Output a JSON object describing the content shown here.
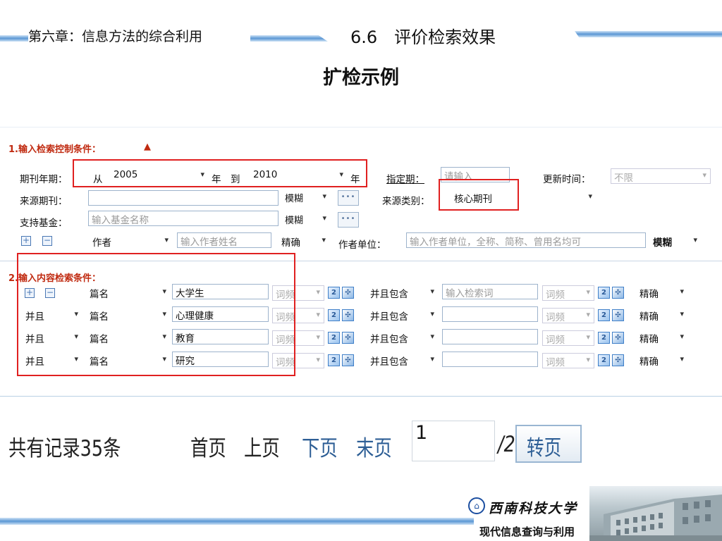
{
  "header": {
    "chapter": "第六章：信息方法的综合利用",
    "section": "6.6　评价检索效果",
    "title": "扩检示例"
  },
  "control": {
    "heading": "1.输入检索控制条件：",
    "year_label": "期刊年期：",
    "from": "从",
    "from_value": "2005",
    "year": "年",
    "to": "到",
    "to_value": "2010",
    "year2": "年",
    "period_label": "指定期：",
    "period_ph": "请输入",
    "update_label": "更新时间：",
    "update_value": "不限",
    "source_label": "来源期刊：",
    "fuzzy": "模糊",
    "type_label": "来源类别：",
    "type_value": "核心期刊",
    "fund_label": "支持基金：",
    "fund_ph": "输入基金名称",
    "fuzzy2": "模糊",
    "author_sel": "作者",
    "author_ph": "输入作者姓名",
    "exact": "精确",
    "unit_label": "作者单位：",
    "unit_ph": "输入作者单位，全称、简称、曾用名均可",
    "fuzzy3": "模糊"
  },
  "content": {
    "heading": "2.输入内容检索条件：",
    "rows": [
      {
        "logic": "",
        "field": "篇名",
        "term": "大学生",
        "freq": "词频",
        "op": "并且包含",
        "term2_ph": "输入检索词",
        "freq2": "词频",
        "match": "精确"
      },
      {
        "logic": "并且",
        "field": "篇名",
        "term": "心理健康",
        "freq": "词频",
        "op": "并且包含",
        "term2_ph": "",
        "freq2": "词频",
        "match": "精确"
      },
      {
        "logic": "并且",
        "field": "篇名",
        "term": "教育",
        "freq": "词频",
        "op": "并且包含",
        "term2_ph": "",
        "freq2": "词频",
        "match": "精确"
      },
      {
        "logic": "并且",
        "field": "篇名",
        "term": "研究",
        "freq": "词频",
        "op": "并且包含",
        "term2_ph": "",
        "freq2": "词频",
        "match": "精确"
      }
    ]
  },
  "pager": {
    "total": "共有记录35条",
    "first": "首页",
    "prev": "上页",
    "next": "下页",
    "last": "末页",
    "page": "1",
    "of": "/2",
    "go": "转页"
  },
  "footer": {
    "university": "西南科技大学",
    "course": "现代信息查询与利用"
  }
}
